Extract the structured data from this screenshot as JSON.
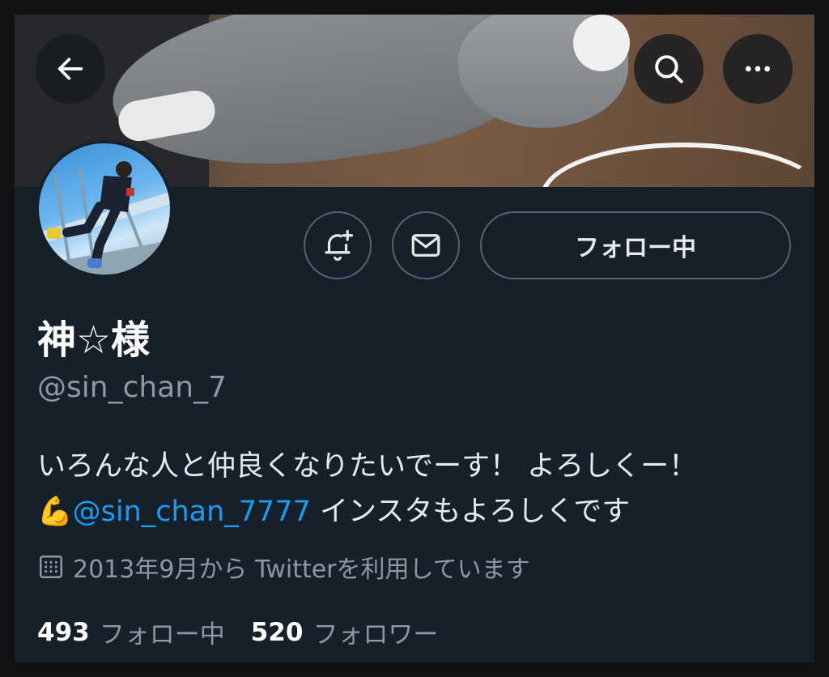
{
  "header": {
    "back_icon": "arrow-left-icon",
    "search_icon": "search-icon",
    "more_icon": "more-horizontal-icon"
  },
  "actions": {
    "notify_icon": "bell-plus-icon",
    "message_icon": "envelope-icon",
    "follow_label": "フォロー中"
  },
  "profile": {
    "name": "神☆様",
    "handle": "@sin_chan_7",
    "bio_line1": "いろんな人と仲良くなりたいでーす！ よろしくー！",
    "bio_emoji": "💪",
    "bio_mention": "@sin_chan_7777",
    "bio_line2_rest": " インスタもよろしくです",
    "joined": "2013年9月から Twitterを利用しています"
  },
  "stats": {
    "following_count": "493",
    "following_label": "フォロー中",
    "followers_count": "520",
    "followers_label": "フォロワー"
  },
  "colors": {
    "background": "#15202b",
    "accent": "#1d9bf0",
    "secondary_text": "#8b98a5",
    "border": "#536471"
  }
}
